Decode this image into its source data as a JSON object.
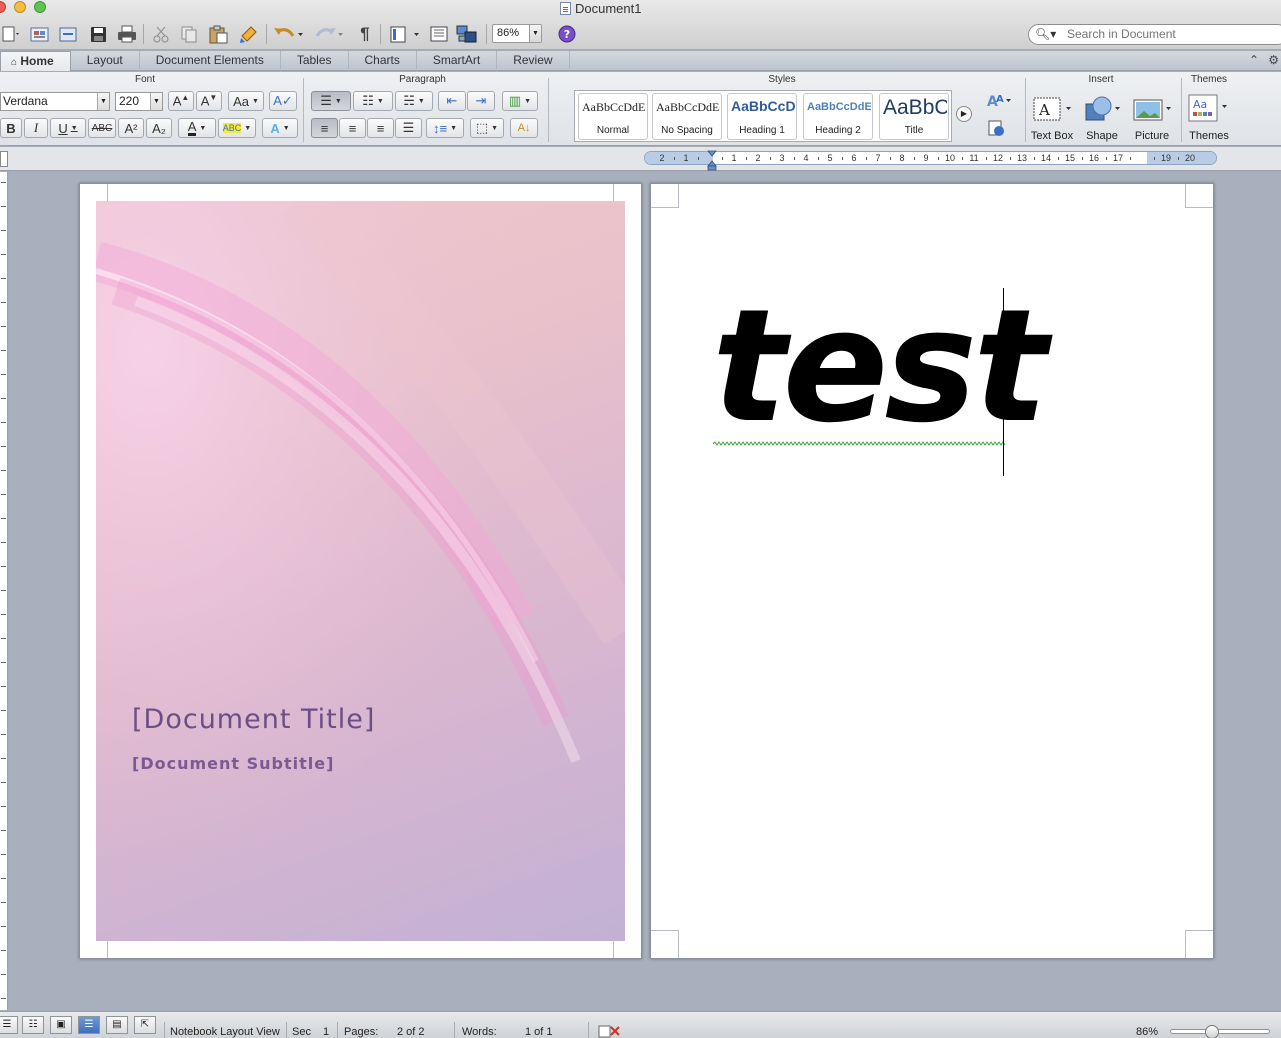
{
  "window": {
    "title": "Document1",
    "colors": {
      "close": "#ee5b52",
      "minimize": "#f6bc3b",
      "zoom": "#5fc44a"
    }
  },
  "toolbar": {
    "zoom_value": "86%",
    "search_placeholder": "Search in Document",
    "icons": [
      "new-document-icon",
      "templates-icon",
      "open-icon",
      "save-icon",
      "print-icon",
      "cut-icon",
      "copy-icon",
      "paste-icon",
      "format-painter-icon",
      "undo-icon",
      "redo-icon",
      "pilcrow-icon",
      "view-icon",
      "sidebar-icon",
      "media-browser-icon",
      "help-icon"
    ]
  },
  "tabs": [
    {
      "label": "Home",
      "active": true
    },
    {
      "label": "Layout",
      "active": false
    },
    {
      "label": "Document Elements",
      "active": false
    },
    {
      "label": "Tables",
      "active": false
    },
    {
      "label": "Charts",
      "active": false
    },
    {
      "label": "SmartArt",
      "active": false
    },
    {
      "label": "Review",
      "active": false
    }
  ],
  "ribbon": {
    "groups": {
      "font": "Font",
      "paragraph": "Paragraph",
      "styles": "Styles",
      "insert": "Insert",
      "themes": "Themes"
    },
    "font_name": "Verdana",
    "font_size": "220",
    "font_buttons": {
      "bold": "B",
      "italic": "I",
      "underline": "U",
      "strikethrough": "ABC",
      "superscript": "A²",
      "subscript": "A₂"
    },
    "styles": [
      {
        "sample": "AaBbCcDdEe",
        "name": "Normal",
        "color": "#222222"
      },
      {
        "sample": "AaBbCcDdEe",
        "name": "No Spacing",
        "color": "#222222"
      },
      {
        "sample": "AaBbCcDc",
        "name": "Heading 1",
        "color": "#2e5d98"
      },
      {
        "sample": "AaBbCcDdEe",
        "name": "Heading 2",
        "color": "#4f81bd"
      },
      {
        "sample": "AaBbC",
        "name": "Title",
        "color": "#1f3c64"
      }
    ],
    "insert_buttons": [
      "Text Box",
      "Shape",
      "Picture"
    ],
    "themes_button": "Themes"
  },
  "ruler": {
    "labels": [
      "2",
      "1",
      "",
      "1",
      "2",
      "3",
      "4",
      "5",
      "6",
      "7",
      "8",
      "9",
      "10",
      "11",
      "12",
      "13",
      "14",
      "15",
      "16",
      "17",
      "",
      "19",
      "20"
    ]
  },
  "document": {
    "cover_title": "[Document Title]",
    "cover_subtitle": "[Document Subtitle]",
    "body_text": "test"
  },
  "status": {
    "view_name": "Notebook Layout View",
    "sec_label": "Sec",
    "sec_value": "1",
    "pages_label": "Pages:",
    "pages_value": "2 of 2",
    "words_label": "Words:",
    "words_value": "1 of 1",
    "zoom": "86%"
  }
}
